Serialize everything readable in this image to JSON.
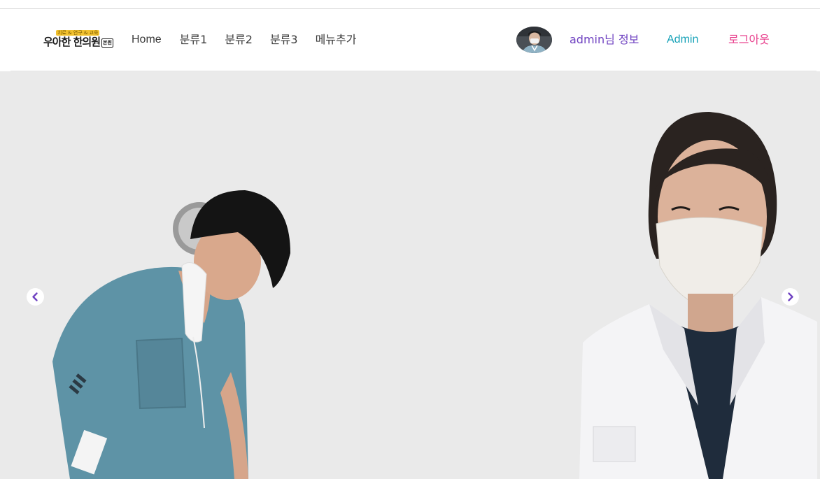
{
  "header": {
    "logo": {
      "tagline": "치료 & 연구 & 교육",
      "brand_name": "우아한 한의원",
      "badge": "본원"
    },
    "nav": [
      {
        "label": "Home"
      },
      {
        "label": "분류1"
      },
      {
        "label": "분류2"
      },
      {
        "label": "분류3"
      },
      {
        "label": "메뉴추가"
      }
    ],
    "user": {
      "info_label": "admin님 정보",
      "admin_label": "Admin",
      "logout_label": "로그아웃"
    }
  },
  "colors": {
    "info": "#6f42c1",
    "admin": "#17a2b8",
    "logout": "#e83e8c",
    "carousel_bg": "#eaeaea",
    "arrow": "#6f42c1"
  },
  "carousel": {
    "prev_icon": "chevron-left-icon",
    "next_icon": "chevron-right-icon"
  }
}
